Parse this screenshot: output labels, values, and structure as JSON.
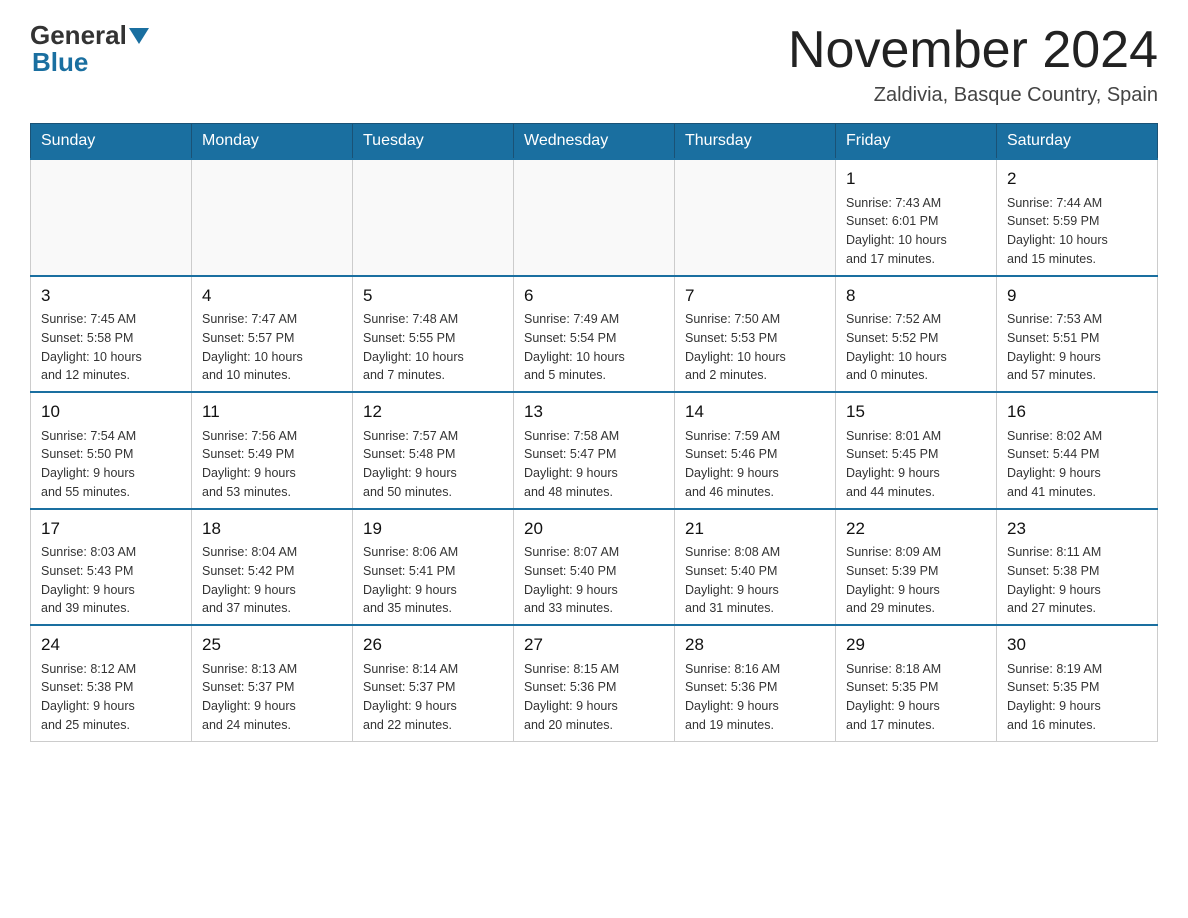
{
  "header": {
    "month_title": "November 2024",
    "location": "Zaldivia, Basque Country, Spain",
    "logo_general": "General",
    "logo_blue": "Blue"
  },
  "days_of_week": [
    "Sunday",
    "Monday",
    "Tuesday",
    "Wednesday",
    "Thursday",
    "Friday",
    "Saturday"
  ],
  "weeks": [
    [
      {
        "day": "",
        "info": ""
      },
      {
        "day": "",
        "info": ""
      },
      {
        "day": "",
        "info": ""
      },
      {
        "day": "",
        "info": ""
      },
      {
        "day": "",
        "info": ""
      },
      {
        "day": "1",
        "info": "Sunrise: 7:43 AM\nSunset: 6:01 PM\nDaylight: 10 hours\nand 17 minutes."
      },
      {
        "day": "2",
        "info": "Sunrise: 7:44 AM\nSunset: 5:59 PM\nDaylight: 10 hours\nand 15 minutes."
      }
    ],
    [
      {
        "day": "3",
        "info": "Sunrise: 7:45 AM\nSunset: 5:58 PM\nDaylight: 10 hours\nand 12 minutes."
      },
      {
        "day": "4",
        "info": "Sunrise: 7:47 AM\nSunset: 5:57 PM\nDaylight: 10 hours\nand 10 minutes."
      },
      {
        "day": "5",
        "info": "Sunrise: 7:48 AM\nSunset: 5:55 PM\nDaylight: 10 hours\nand 7 minutes."
      },
      {
        "day": "6",
        "info": "Sunrise: 7:49 AM\nSunset: 5:54 PM\nDaylight: 10 hours\nand 5 minutes."
      },
      {
        "day": "7",
        "info": "Sunrise: 7:50 AM\nSunset: 5:53 PM\nDaylight: 10 hours\nand 2 minutes."
      },
      {
        "day": "8",
        "info": "Sunrise: 7:52 AM\nSunset: 5:52 PM\nDaylight: 10 hours\nand 0 minutes."
      },
      {
        "day": "9",
        "info": "Sunrise: 7:53 AM\nSunset: 5:51 PM\nDaylight: 9 hours\nand 57 minutes."
      }
    ],
    [
      {
        "day": "10",
        "info": "Sunrise: 7:54 AM\nSunset: 5:50 PM\nDaylight: 9 hours\nand 55 minutes."
      },
      {
        "day": "11",
        "info": "Sunrise: 7:56 AM\nSunset: 5:49 PM\nDaylight: 9 hours\nand 53 minutes."
      },
      {
        "day": "12",
        "info": "Sunrise: 7:57 AM\nSunset: 5:48 PM\nDaylight: 9 hours\nand 50 minutes."
      },
      {
        "day": "13",
        "info": "Sunrise: 7:58 AM\nSunset: 5:47 PM\nDaylight: 9 hours\nand 48 minutes."
      },
      {
        "day": "14",
        "info": "Sunrise: 7:59 AM\nSunset: 5:46 PM\nDaylight: 9 hours\nand 46 minutes."
      },
      {
        "day": "15",
        "info": "Sunrise: 8:01 AM\nSunset: 5:45 PM\nDaylight: 9 hours\nand 44 minutes."
      },
      {
        "day": "16",
        "info": "Sunrise: 8:02 AM\nSunset: 5:44 PM\nDaylight: 9 hours\nand 41 minutes."
      }
    ],
    [
      {
        "day": "17",
        "info": "Sunrise: 8:03 AM\nSunset: 5:43 PM\nDaylight: 9 hours\nand 39 minutes."
      },
      {
        "day": "18",
        "info": "Sunrise: 8:04 AM\nSunset: 5:42 PM\nDaylight: 9 hours\nand 37 minutes."
      },
      {
        "day": "19",
        "info": "Sunrise: 8:06 AM\nSunset: 5:41 PM\nDaylight: 9 hours\nand 35 minutes."
      },
      {
        "day": "20",
        "info": "Sunrise: 8:07 AM\nSunset: 5:40 PM\nDaylight: 9 hours\nand 33 minutes."
      },
      {
        "day": "21",
        "info": "Sunrise: 8:08 AM\nSunset: 5:40 PM\nDaylight: 9 hours\nand 31 minutes."
      },
      {
        "day": "22",
        "info": "Sunrise: 8:09 AM\nSunset: 5:39 PM\nDaylight: 9 hours\nand 29 minutes."
      },
      {
        "day": "23",
        "info": "Sunrise: 8:11 AM\nSunset: 5:38 PM\nDaylight: 9 hours\nand 27 minutes."
      }
    ],
    [
      {
        "day": "24",
        "info": "Sunrise: 8:12 AM\nSunset: 5:38 PM\nDaylight: 9 hours\nand 25 minutes."
      },
      {
        "day": "25",
        "info": "Sunrise: 8:13 AM\nSunset: 5:37 PM\nDaylight: 9 hours\nand 24 minutes."
      },
      {
        "day": "26",
        "info": "Sunrise: 8:14 AM\nSunset: 5:37 PM\nDaylight: 9 hours\nand 22 minutes."
      },
      {
        "day": "27",
        "info": "Sunrise: 8:15 AM\nSunset: 5:36 PM\nDaylight: 9 hours\nand 20 minutes."
      },
      {
        "day": "28",
        "info": "Sunrise: 8:16 AM\nSunset: 5:36 PM\nDaylight: 9 hours\nand 19 minutes."
      },
      {
        "day": "29",
        "info": "Sunrise: 8:18 AM\nSunset: 5:35 PM\nDaylight: 9 hours\nand 17 minutes."
      },
      {
        "day": "30",
        "info": "Sunrise: 8:19 AM\nSunset: 5:35 PM\nDaylight: 9 hours\nand 16 minutes."
      }
    ]
  ]
}
